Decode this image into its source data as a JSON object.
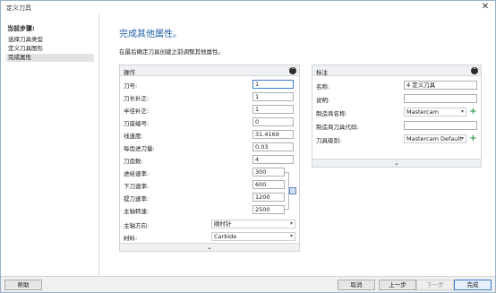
{
  "window": {
    "title": "定义刀具",
    "close_glyph": "✕"
  },
  "sidebar": {
    "heading": "当前步骤:",
    "steps": [
      {
        "label": "选择刀具类型"
      },
      {
        "label": "定义刀具图形"
      },
      {
        "label": "完成属性"
      }
    ]
  },
  "main": {
    "title": "完成其他属性。",
    "description": "在最后确定刀具创建之前调整其他属性。"
  },
  "operation_panel": {
    "title": "操作",
    "fields": [
      {
        "label": "刀号:",
        "value": "1"
      },
      {
        "label": "刀长补正:",
        "value": "1"
      },
      {
        "label": "半径补正:",
        "value": "1"
      },
      {
        "label": "刀座编号:",
        "value": "0"
      },
      {
        "label": "线速度:",
        "value": "31.4169"
      },
      {
        "label": "每齿进刀量:",
        "value": "0.03"
      },
      {
        "label": "刀齿数:",
        "value": "4"
      },
      {
        "label": "进给速率:",
        "value": "300"
      },
      {
        "label": "下刀速率:",
        "value": "600"
      },
      {
        "label": "提刀速率:",
        "value": "1200"
      },
      {
        "label": "主轴转速:",
        "value": "2500"
      }
    ],
    "spindle_direction": {
      "label": "主轴方向:",
      "value": "顺时针"
    },
    "material": {
      "label": "材料:",
      "value": "Carbide"
    }
  },
  "label_panel": {
    "title": "标注",
    "name": {
      "label": "名称:",
      "value": "4 定义刀具"
    },
    "note": {
      "label": "说明:",
      "value": ""
    },
    "manufacturer": {
      "label": "制造商名称:",
      "value": "Mastercam"
    },
    "manufacturer_code": {
      "label": "制造商刀具代码:",
      "value": ""
    },
    "tool_grade": {
      "label": "刀具级别:",
      "value": "Mastercam Default"
    }
  },
  "buttons": {
    "help": "帮助",
    "cancel": "取消",
    "prev": "上一步",
    "next": "下一步",
    "finish": "完成"
  },
  "icons": {
    "collapse": "⌃",
    "expand": "⌄",
    "dropdown": "▾",
    "plus": "+"
  },
  "colors": {
    "title_blue": "#1f5fa8",
    "add_green": "#2c9a3f",
    "focus_blue": "#3d7bd0"
  }
}
